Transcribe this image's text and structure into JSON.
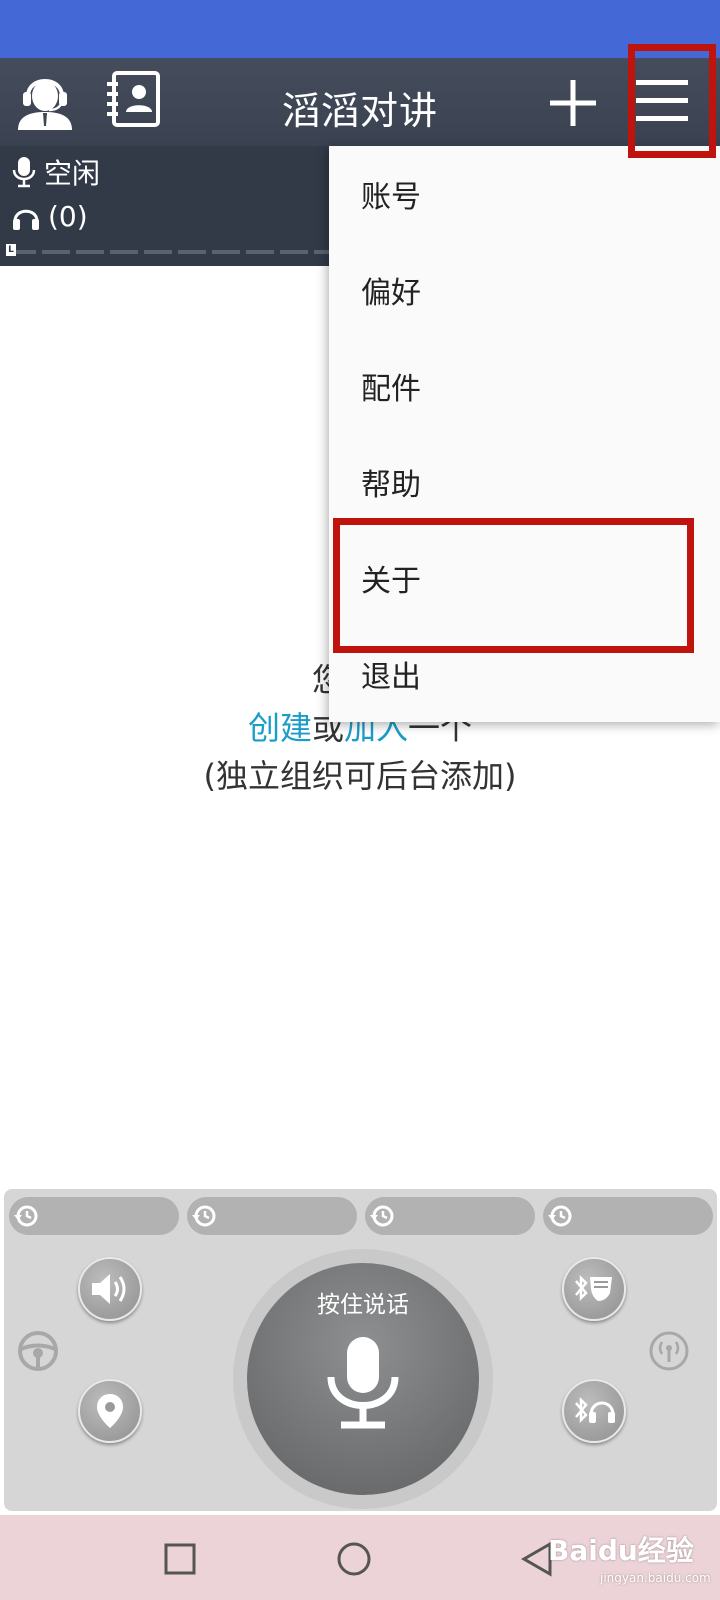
{
  "app": {
    "title": "滔滔对讲"
  },
  "status": {
    "mic_state": "空闲",
    "listener_count": "(0)",
    "level_marker": "L"
  },
  "menu": {
    "items": [
      {
        "label": "账号"
      },
      {
        "label": "偏好"
      },
      {
        "label": "配件"
      },
      {
        "label": "帮助"
      },
      {
        "label": "关于"
      },
      {
        "label": "退出"
      }
    ]
  },
  "empty_state": {
    "line1_visible": "您还没",
    "create_link": "创建",
    "or": "或",
    "join_link": "加入",
    "line2_tail": "一个",
    "line3": "(独立组织可后台添加)"
  },
  "ptt": {
    "label": "按住说话"
  },
  "watermark": {
    "text": "Baidu经验",
    "sub": "jingyan.baidu.com"
  },
  "colors": {
    "status_bar": "#4469d6",
    "app_bar": "#3f4755",
    "highlight": "#c0130d",
    "link": "#1b9dc9"
  }
}
